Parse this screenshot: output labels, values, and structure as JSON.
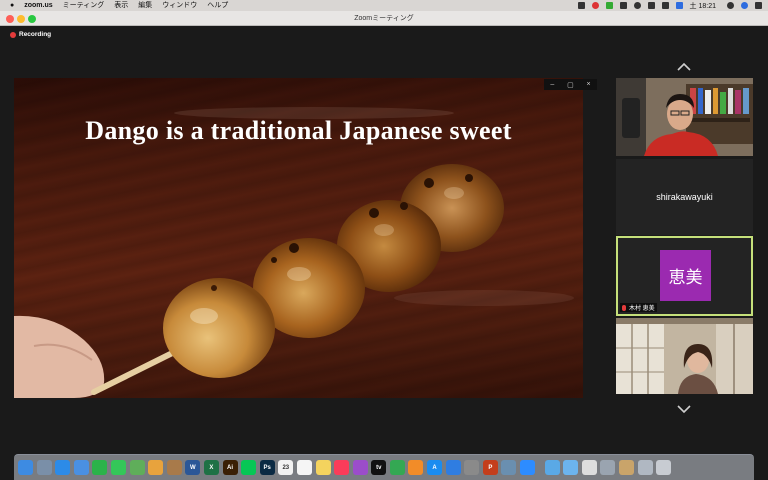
{
  "menubar": {
    "app": "zoom.us",
    "items": [
      "ミーティング",
      "表示",
      "編集",
      "ウィンドウ",
      "ヘルプ"
    ],
    "status_icons": [
      "dropbox-icon",
      "record-icon",
      "line-icon",
      "screen-icon",
      "wifi-icon",
      "sound-icon",
      "battery-icon",
      "flag-icon"
    ],
    "clock": "土 18:21"
  },
  "window": {
    "title": "Zoomミーティング"
  },
  "recording": {
    "label": "Recording",
    "color": "#e43b3b"
  },
  "share": {
    "title": "Dango is a traditional Japanese sweet",
    "controls": [
      "–",
      "▢",
      "×"
    ]
  },
  "participants": [
    {
      "name": "",
      "type": "video-man"
    },
    {
      "name": "shirakawayuki",
      "type": "name-only"
    },
    {
      "name": "木村 恵美",
      "avatar": "恵美",
      "avatar_color": "#9b2ab0",
      "muted": true,
      "active_speaker": true
    },
    {
      "name": "",
      "type": "video-woman"
    }
  ],
  "dock": {
    "icons": [
      {
        "name": "finder-icon",
        "color": "#3d8be2",
        "label": ""
      },
      {
        "name": "launchpad-icon",
        "color": "#7a8fa8",
        "label": ""
      },
      {
        "name": "safari-icon",
        "color": "#2c8be8",
        "label": ""
      },
      {
        "name": "mail-icon",
        "color": "#4a90e2",
        "label": ""
      },
      {
        "name": "facetime-icon",
        "color": "#2bb34a",
        "label": ""
      },
      {
        "name": "messages-icon",
        "color": "#34c759",
        "label": ""
      },
      {
        "name": "maps-icon",
        "color": "#5fae5a",
        "label": ""
      },
      {
        "name": "photos-icon",
        "color": "#e8a33d",
        "label": ""
      },
      {
        "name": "contacts-icon",
        "color": "#a87a4a",
        "label": ""
      },
      {
        "name": "word-icon",
        "color": "#2b5797",
        "label": "W"
      },
      {
        "name": "excel-icon",
        "color": "#1e7145",
        "label": "X"
      },
      {
        "name": "illustrator-icon",
        "color": "#3a1f05",
        "label": "Ai"
      },
      {
        "name": "line-icon",
        "color": "#06c755",
        "label": ""
      },
      {
        "name": "photoshop-icon",
        "color": "#0a2a43",
        "label": "Ps"
      },
      {
        "name": "calendar-icon",
        "color": "#f2f2f2",
        "label": "23"
      },
      {
        "name": "reminders-icon",
        "color": "#f5f5f5",
        "label": ""
      },
      {
        "name": "notes-icon",
        "color": "#f4d35e",
        "label": ""
      },
      {
        "name": "music-icon",
        "color": "#fa3c5a",
        "label": ""
      },
      {
        "name": "podcasts-icon",
        "color": "#9b4dca",
        "label": ""
      },
      {
        "name": "tv-icon",
        "color": "#111111",
        "label": "tv"
      },
      {
        "name": "numbers-icon",
        "color": "#34a853",
        "label": ""
      },
      {
        "name": "pages-icon",
        "color": "#f28c28",
        "label": ""
      },
      {
        "name": "app-store-icon",
        "color": "#1a8cf0",
        "label": "A"
      },
      {
        "name": "keynote-icon",
        "color": "#2f7de1",
        "label": ""
      },
      {
        "name": "system-preferences-icon",
        "color": "#8a8a8a",
        "label": ""
      },
      {
        "name": "powerpoint-icon",
        "color": "#c43e1c",
        "label": "P"
      },
      {
        "name": "preview-icon",
        "color": "#6a8fb0",
        "label": ""
      },
      {
        "name": "zoom-icon",
        "color": "#2d8cff",
        "label": ""
      },
      {
        "name": "folder-icon",
        "color": "#5aa9e6",
        "label": ""
      },
      {
        "name": "downloads-icon",
        "color": "#6cb4ee",
        "label": ""
      },
      {
        "name": "document-icon",
        "color": "#dddddd",
        "label": ""
      },
      {
        "name": "screenshot-icon",
        "color": "#9aa4b0",
        "label": ""
      },
      {
        "name": "image-icon",
        "color": "#c9a46a",
        "label": ""
      },
      {
        "name": "window-icon",
        "color": "#b0b8c2",
        "label": ""
      },
      {
        "name": "trash-icon",
        "color": "#c8ccd2",
        "label": ""
      }
    ]
  }
}
